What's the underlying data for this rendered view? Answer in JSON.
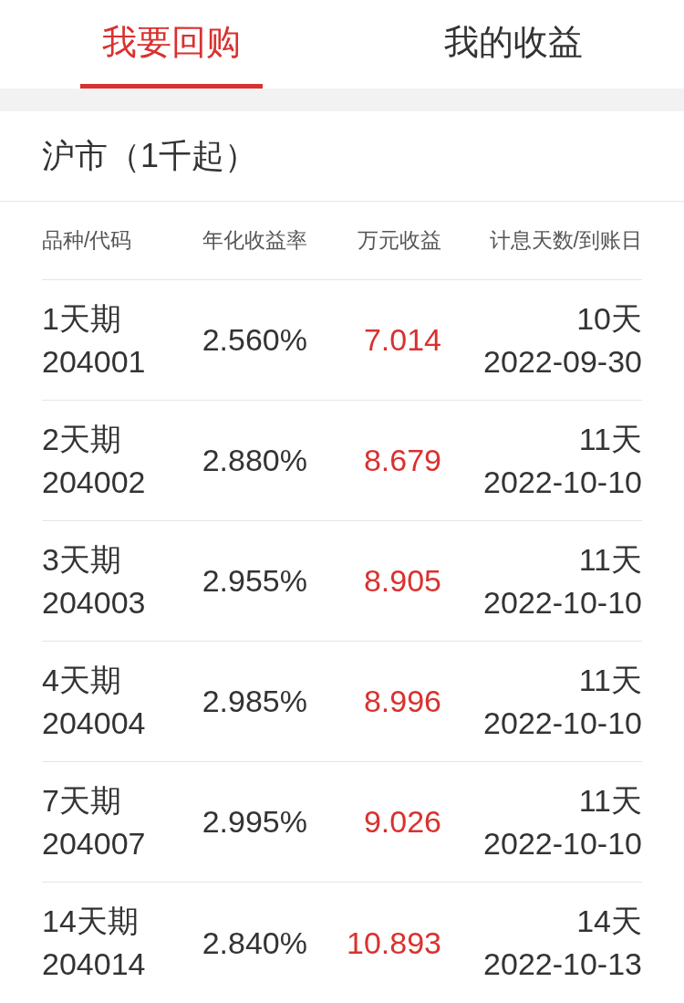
{
  "tabs": [
    {
      "label": "我要回购",
      "selected": true
    },
    {
      "label": "我的收益",
      "selected": false
    }
  ],
  "section": {
    "title": "沪市（1千起）"
  },
  "table": {
    "columns": [
      "品种/代码",
      "年化收益率",
      "万元收益",
      "计息天数/到账日"
    ],
    "rows": [
      {
        "name": "1天期",
        "code": "204001",
        "rate": "2.560%",
        "yield": "7.014",
        "days": "10天",
        "date": "2022-09-30"
      },
      {
        "name": "2天期",
        "code": "204002",
        "rate": "2.880%",
        "yield": "8.679",
        "days": "11天",
        "date": "2022-10-10"
      },
      {
        "name": "3天期",
        "code": "204003",
        "rate": "2.955%",
        "yield": "8.905",
        "days": "11天",
        "date": "2022-10-10"
      },
      {
        "name": "4天期",
        "code": "204004",
        "rate": "2.985%",
        "yield": "8.996",
        "days": "11天",
        "date": "2022-10-10"
      },
      {
        "name": "7天期",
        "code": "204007",
        "rate": "2.995%",
        "yield": "9.026",
        "days": "11天",
        "date": "2022-10-10"
      },
      {
        "name": "14天期",
        "code": "204014",
        "rate": "2.840%",
        "yield": "10.893",
        "days": "14天",
        "date": "2022-10-13"
      }
    ]
  }
}
